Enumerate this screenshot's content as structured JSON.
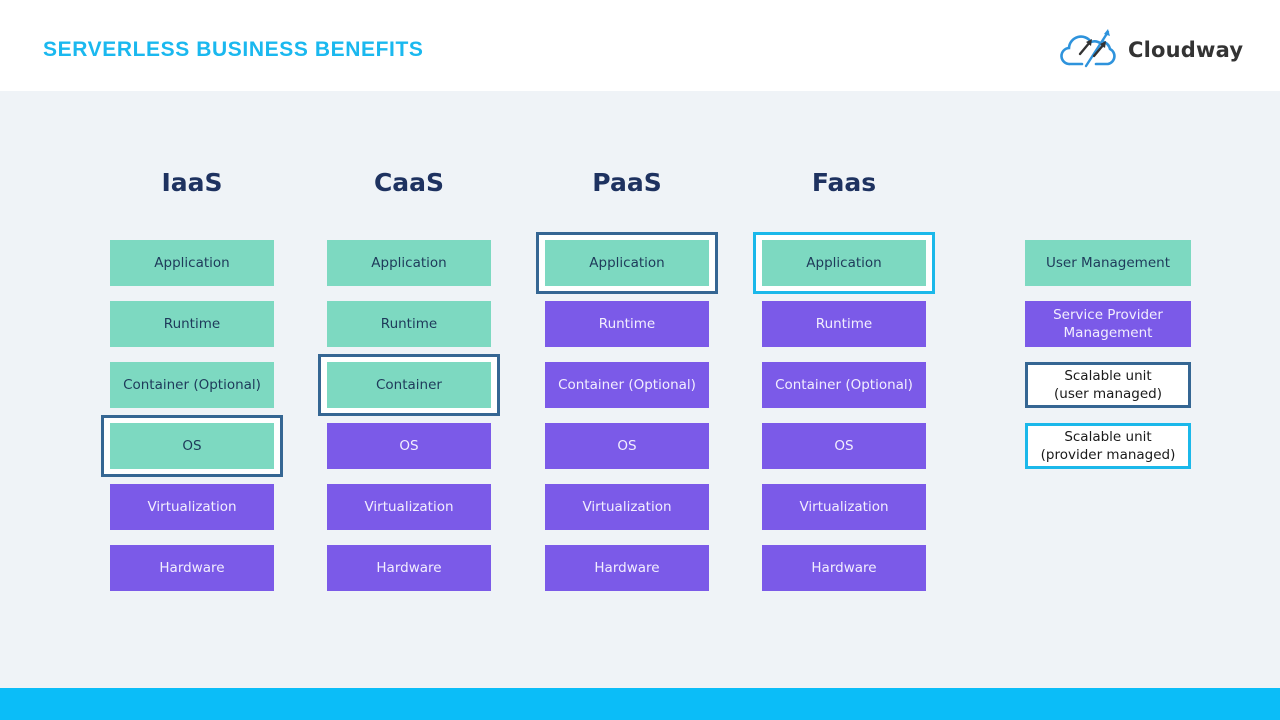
{
  "header": {
    "title": "SERVERLESS BUSINESS BENEFITS",
    "logo": {
      "icon": "cloud-arrows-icon",
      "text": "Cloudway"
    }
  },
  "colors": {
    "title_blue": "#1ab8ef",
    "user_managed": "#7dd9c1",
    "provider_managed": "#7b5ae8",
    "scalable_user_border": "#356693",
    "scalable_provider_border": "#1bb8ea",
    "heading_navy": "#1e3260",
    "footer_bar": "#0bbdf8",
    "background": "#eff3f7"
  },
  "columns": [
    {
      "title": "IaaS",
      "layers": [
        {
          "label": "Application",
          "managed_by": "user"
        },
        {
          "label": "Runtime",
          "managed_by": "user"
        },
        {
          "label": "Container (Optional)",
          "managed_by": "user"
        },
        {
          "label": "OS",
          "managed_by": "user",
          "scalable_unit": "user"
        },
        {
          "label": "Virtualization",
          "managed_by": "provider"
        },
        {
          "label": "Hardware",
          "managed_by": "provider"
        }
      ]
    },
    {
      "title": "CaaS",
      "layers": [
        {
          "label": "Application",
          "managed_by": "user"
        },
        {
          "label": "Runtime",
          "managed_by": "user"
        },
        {
          "label": "Container",
          "managed_by": "user",
          "scalable_unit": "user"
        },
        {
          "label": "OS",
          "managed_by": "provider"
        },
        {
          "label": "Virtualization",
          "managed_by": "provider"
        },
        {
          "label": "Hardware",
          "managed_by": "provider"
        }
      ]
    },
    {
      "title": "PaaS",
      "layers": [
        {
          "label": "Application",
          "managed_by": "user",
          "scalable_unit": "user"
        },
        {
          "label": "Runtime",
          "managed_by": "provider"
        },
        {
          "label": "Container (Optional)",
          "managed_by": "provider"
        },
        {
          "label": "OS",
          "managed_by": "provider"
        },
        {
          "label": "Virtualization",
          "managed_by": "provider"
        },
        {
          "label": "Hardware",
          "managed_by": "provider"
        }
      ]
    },
    {
      "title": "Faas",
      "layers": [
        {
          "label": "Application",
          "managed_by": "user",
          "scalable_unit": "provider"
        },
        {
          "label": "Runtime",
          "managed_by": "provider"
        },
        {
          "label": "Container (Optional)",
          "managed_by": "provider"
        },
        {
          "label": "OS",
          "managed_by": "provider"
        },
        {
          "label": "Virtualization",
          "managed_by": "provider"
        },
        {
          "label": "Hardware",
          "managed_by": "provider"
        }
      ]
    }
  ],
  "legend": [
    {
      "type": "user",
      "lines": [
        "User Management"
      ]
    },
    {
      "type": "provider",
      "lines": [
        "Service Provider",
        "Management"
      ]
    },
    {
      "type": "scal-user",
      "lines": [
        "Scalable unit",
        "(user managed)"
      ]
    },
    {
      "type": "scal-prov",
      "lines": [
        "Scalable unit",
        "(provider managed)"
      ]
    }
  ]
}
